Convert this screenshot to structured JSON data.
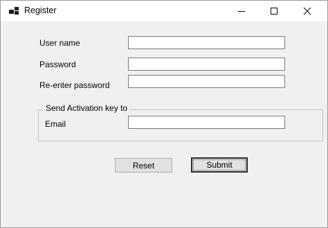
{
  "window": {
    "title": "Register",
    "controls": {
      "minimize_icon": "minimize-icon",
      "maximize_icon": "maximize-icon",
      "close_icon": "close-icon"
    }
  },
  "form": {
    "username_label": "User name",
    "username_value": "",
    "password_label": "Password",
    "password_value": "",
    "reenter_label": "Re-enter password",
    "reenter_value": "",
    "activation_group_label": "Send Activation key to",
    "email_label": "Email",
    "email_value": ""
  },
  "buttons": {
    "reset_label": "Reset",
    "submit_label": "Submit"
  },
  "colors": {
    "window_bg": "#f0f0f0",
    "titlebar_bg": "#ffffff",
    "button_bg": "#e1e1e1",
    "textbox_border": "#7a7a7a"
  }
}
